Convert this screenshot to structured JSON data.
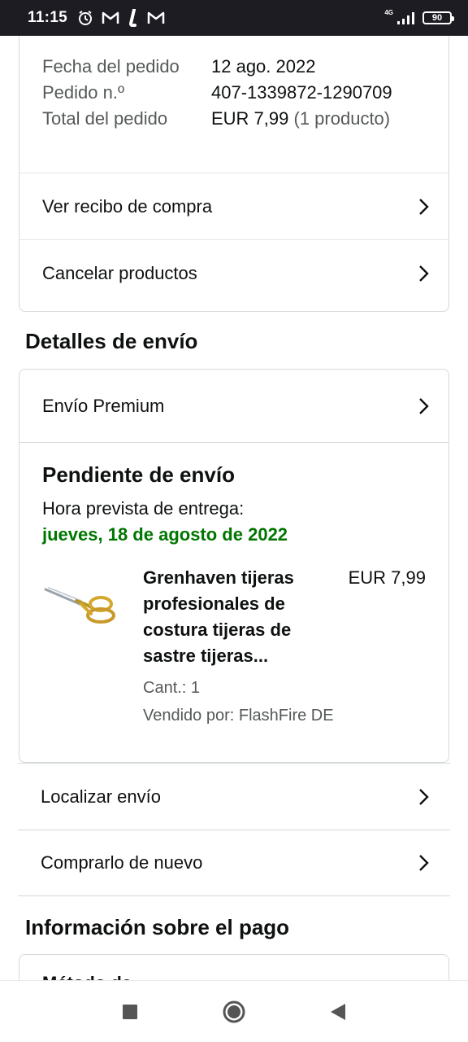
{
  "status_bar": {
    "time": "11:15",
    "network": "4G",
    "battery": "90",
    "icons": [
      "alarm-icon",
      "gmail-icon",
      "app-l-icon",
      "gmail-icon",
      "signal-icon",
      "battery-icon"
    ]
  },
  "order_summary": {
    "rows": [
      {
        "label": "Fecha del pedido",
        "value": "12 ago. 2022",
        "extra": ""
      },
      {
        "label": "Pedido n.º",
        "value": "407-1339872-1290709",
        "extra": ""
      },
      {
        "label": "Total del pedido",
        "value": "EUR 7,99",
        "extra": " (1 producto)"
      }
    ],
    "links": [
      "Ver recibo de compra",
      "Cancelar productos"
    ]
  },
  "shipping": {
    "section_title": "Detalles de envío",
    "service": "Envío Premium",
    "status": "Pendiente de envío",
    "eta_label": "Hora prevista de entrega:",
    "eta_date": "jueves, 18 de agosto de 2022",
    "product": {
      "title": "Grenhaven tijeras profesionales de costura tijeras de sastre tijeras...",
      "price": "EUR 7,99",
      "quantity": "Cant.: 1",
      "seller": "Vendido por: FlashFire DE",
      "image_icon": "scissors-icon"
    },
    "actions": [
      "Localizar envío",
      "Comprarlo de nuevo"
    ]
  },
  "payment": {
    "section_title": "Información sobre el pago",
    "partial_text": "Método de"
  },
  "nav_bar": {
    "buttons": [
      "recents-button",
      "home-button",
      "back-button"
    ]
  },
  "colors": {
    "accent_green": "#007600",
    "border": "#d5d9d9",
    "muted_text": "#565959",
    "status_bar": "#1c1c22"
  }
}
